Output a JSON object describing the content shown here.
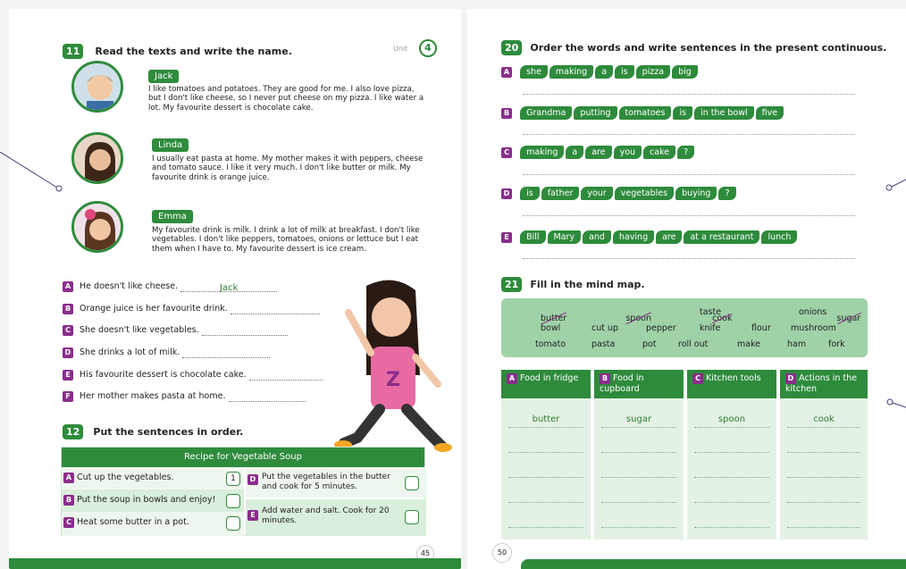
{
  "left": {
    "ex11": {
      "number": "11",
      "instruction": "Read the texts and write the name.",
      "unit_label": "Unit",
      "unit_number": "4",
      "people": [
        {
          "name": "Jack",
          "text": "I like tomatoes and potatoes. They are good for me. I also love pizza, but I don't like cheese, so I never put cheese on my pizza. I like water a lot. My favourite dessert is chocolate cake."
        },
        {
          "name": "Linda",
          "text": "I usually eat pasta at home. My mother makes it with peppers, cheese and tomato sauce. I like it very much. I don't like butter or milk. My favourite drink is orange juice."
        },
        {
          "name": "Emma",
          "text": "My favourite drink is milk. I drink a lot of milk at breakfast. I don't like vegetables. I don't like peppers, tomatoes, onions or lettuce but I eat them when I have to. My favourite dessert is ice cream."
        }
      ],
      "sentences": [
        {
          "letter": "A",
          "text": "He doesn't like cheese.",
          "answer": "Jack"
        },
        {
          "letter": "B",
          "text": "Orange juice is her favourite drink.",
          "answer": ""
        },
        {
          "letter": "C",
          "text": "She doesn't like vegetables.",
          "answer": ""
        },
        {
          "letter": "D",
          "text": "She drinks a lot of milk.",
          "answer": ""
        },
        {
          "letter": "E",
          "text": "His favourite dessert is chocolate cake.",
          "answer": ""
        },
        {
          "letter": "F",
          "text": "Her mother makes pasta at home.",
          "answer": ""
        }
      ]
    },
    "ex12": {
      "number": "12",
      "instruction": "Put the sentences in order.",
      "recipe_title": "Recipe for Vegetable Soup",
      "left_items": [
        {
          "letter": "A",
          "text": "Cut up the vegetables.",
          "order": "1"
        },
        {
          "letter": "B",
          "text": "Put the soup in bowls and enjoy!",
          "order": ""
        },
        {
          "letter": "C",
          "text": "Heat some butter in a pot.",
          "order": ""
        }
      ],
      "right_items": [
        {
          "letter": "D",
          "text": "Put the vegetables in the butter and cook for 5 minutes.",
          "order": ""
        },
        {
          "letter": "E",
          "text": "Add water and salt. Cook for 20 minutes.",
          "order": ""
        }
      ]
    },
    "page_number": "45"
  },
  "right": {
    "ex20": {
      "number": "20",
      "instruction": "Order the words and write sentences in the present continuous.",
      "rows": [
        {
          "letter": "A",
          "words": [
            "she",
            "making",
            "a",
            "is",
            "pizza",
            "big"
          ]
        },
        {
          "letter": "B",
          "words": [
            "Grandma",
            "putting",
            "tomatoes",
            "is",
            "in the bowl",
            "five"
          ]
        },
        {
          "letter": "C",
          "words": [
            "making",
            "a",
            "are",
            "you",
            "cake",
            "?"
          ]
        },
        {
          "letter": "D",
          "words": [
            "is",
            "father",
            "your",
            "vegetables",
            "buying",
            "?"
          ]
        },
        {
          "letter": "E",
          "words": [
            "Bill",
            "Mary",
            "and",
            "having",
            "are",
            "at a restaurant",
            "lunch"
          ]
        }
      ]
    },
    "ex21": {
      "number": "21",
      "instruction": "Fill in the mind map.",
      "word_bank": [
        {
          "word": "butter",
          "crossed": true
        },
        {
          "word": "spoon",
          "crossed": true
        },
        {
          "word": "cook",
          "crossed": true
        },
        {
          "word": "taste",
          "crossed": false
        },
        {
          "word": "sugar",
          "crossed": true
        },
        {
          "word": "onions",
          "crossed": false
        },
        {
          "word": "bowl",
          "crossed": false
        },
        {
          "word": "cut up",
          "crossed": false
        },
        {
          "word": "pepper",
          "crossed": false
        },
        {
          "word": "knife",
          "crossed": false
        },
        {
          "word": "flour",
          "crossed": false
        },
        {
          "word": "mushroom",
          "crossed": false
        },
        {
          "word": "tomato",
          "crossed": false
        },
        {
          "word": "pasta",
          "crossed": false
        },
        {
          "word": "pot",
          "crossed": false
        },
        {
          "word": "roll out",
          "crossed": false
        },
        {
          "word": "make",
          "crossed": false
        },
        {
          "word": "ham",
          "crossed": false
        },
        {
          "word": "fork",
          "crossed": false
        }
      ],
      "columns": [
        {
          "letter": "A",
          "title": "Food in fridge",
          "first_answer": "butter"
        },
        {
          "letter": "B",
          "title": "Food in cupboard",
          "first_answer": "sugar"
        },
        {
          "letter": "C",
          "title": "Kitchen tools",
          "first_answer": "spoon"
        },
        {
          "letter": "D",
          "title": "Actions in the kitchen",
          "first_answer": "cook"
        }
      ]
    },
    "page_number": "50"
  },
  "colors": {
    "green": "#2e8b3c",
    "purple": "#8a2d8c",
    "light_green": "#9fd2a6"
  }
}
